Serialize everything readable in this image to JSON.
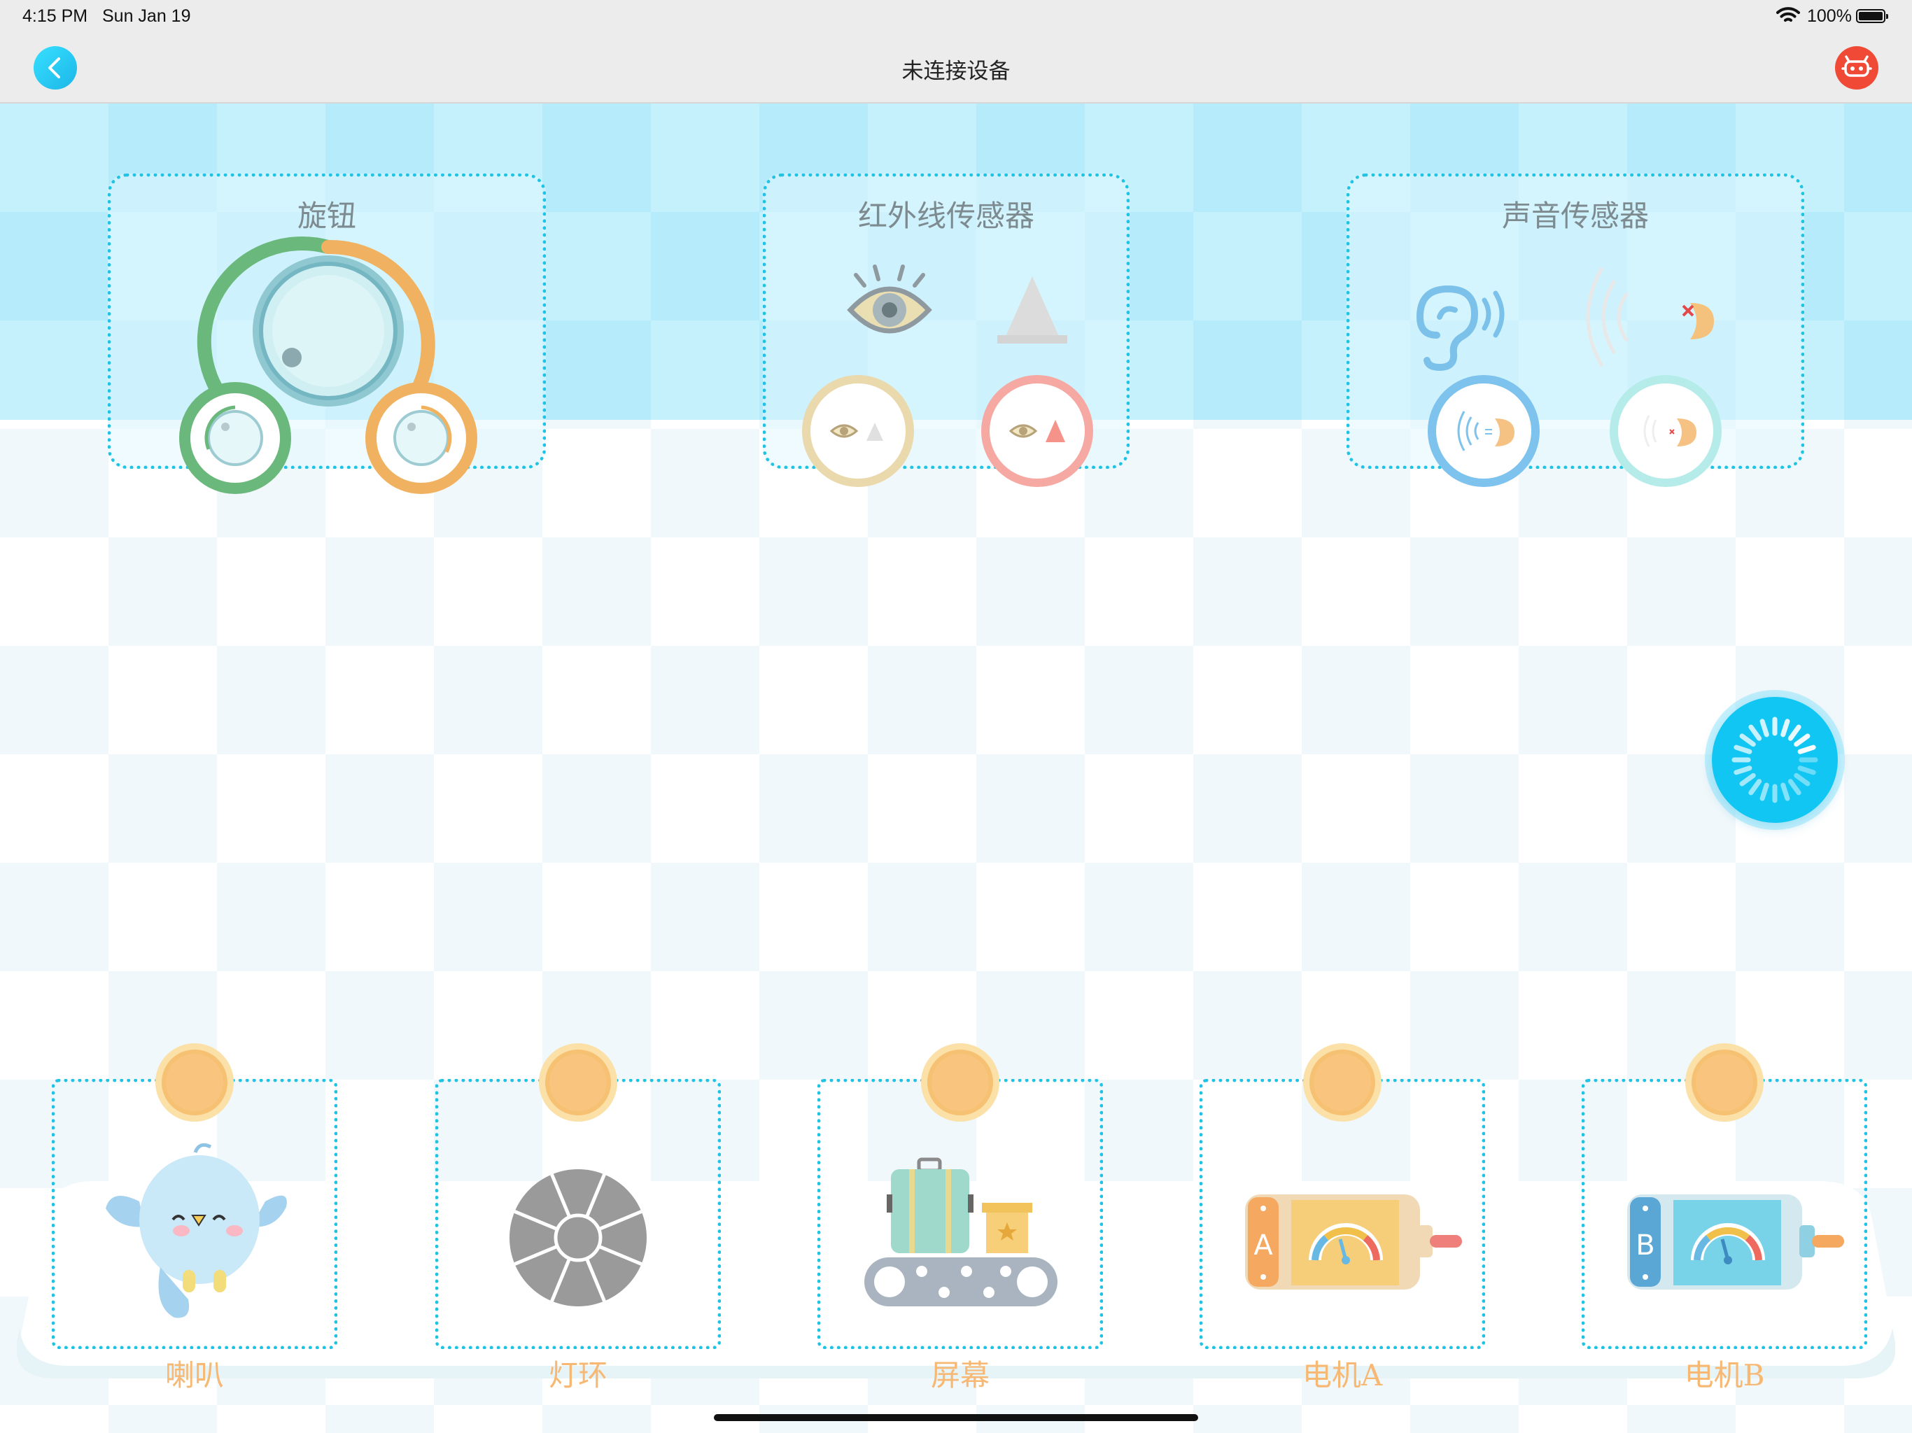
{
  "status_bar": {
    "time": "4:15 PM",
    "date": "Sun Jan 19",
    "battery": "100%"
  },
  "nav": {
    "title": "未连接设备",
    "back_icon": "chevron-left-icon",
    "robot_icon": "robot-icon"
  },
  "sensors": [
    {
      "title": "旋钮",
      "icon": "knob-icon",
      "buttons": [
        "rotate-left-icon",
        "rotate-right-icon"
      ]
    },
    {
      "title": "红外线传感器",
      "icon": "eye-icon",
      "buttons": [
        "ir-no-obstacle-icon",
        "ir-obstacle-icon"
      ]
    },
    {
      "title": "声音传感器",
      "icon": "ear-icon",
      "buttons": [
        "sound-detected-icon",
        "sound-silent-icon"
      ]
    }
  ],
  "actuators": [
    {
      "label": "喇叭",
      "icon": "bird-speaker-icon"
    },
    {
      "label": "灯环",
      "icon": "light-ring-icon"
    },
    {
      "label": "屏幕",
      "icon": "conveyor-screen-icon"
    },
    {
      "label": "电机A",
      "icon": "motor-a-icon"
    },
    {
      "label": "电机B",
      "icon": "motor-b-icon"
    }
  ],
  "colors": {
    "accent": "#1fc3e4",
    "nav_bg": "#ececec",
    "label_orange": "#f7b873",
    "slot_dot": "#f9c47d",
    "robot_button": "#f04a36",
    "loader": "#12c6f4"
  }
}
